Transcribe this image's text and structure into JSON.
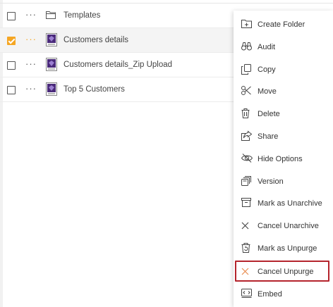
{
  "file_list": {
    "rows": [
      {
        "name": "Templates",
        "type": "folder",
        "checked": false
      },
      {
        "name": "Customers details",
        "type": "report",
        "checked": true
      },
      {
        "name": "Customers details_Zip Upload",
        "type": "report",
        "checked": false
      },
      {
        "name": "Top 5 Customers",
        "type": "report",
        "checked": false
      }
    ],
    "more_glyph": "···"
  },
  "context_menu": {
    "items": [
      {
        "label": "Create Folder",
        "icon": "create-folder-icon"
      },
      {
        "label": "Audit",
        "icon": "audit-binoculars-icon"
      },
      {
        "label": "Copy",
        "icon": "copy-icon"
      },
      {
        "label": "Move",
        "icon": "scissors-icon"
      },
      {
        "label": "Delete",
        "icon": "trash-icon"
      },
      {
        "label": "Share",
        "icon": "share-icon"
      },
      {
        "label": "Hide Options",
        "icon": "eye-slash-icon"
      },
      {
        "label": "Version",
        "icon": "version-icon"
      },
      {
        "label": "Mark as Unarchive",
        "icon": "archive-box-icon"
      },
      {
        "label": "Cancel Unarchive",
        "icon": "close-icon"
      },
      {
        "label": "Mark as Unpurge",
        "icon": "unpurge-bin-icon"
      },
      {
        "label": "Cancel Unpurge",
        "icon": "close-icon",
        "highlighted": true
      },
      {
        "label": "Embed",
        "icon": "embed-code-icon"
      }
    ]
  },
  "colors": {
    "accent": "#f5a623",
    "highlight_border": "#b5242c",
    "report_icon": "#4a2a7a"
  }
}
